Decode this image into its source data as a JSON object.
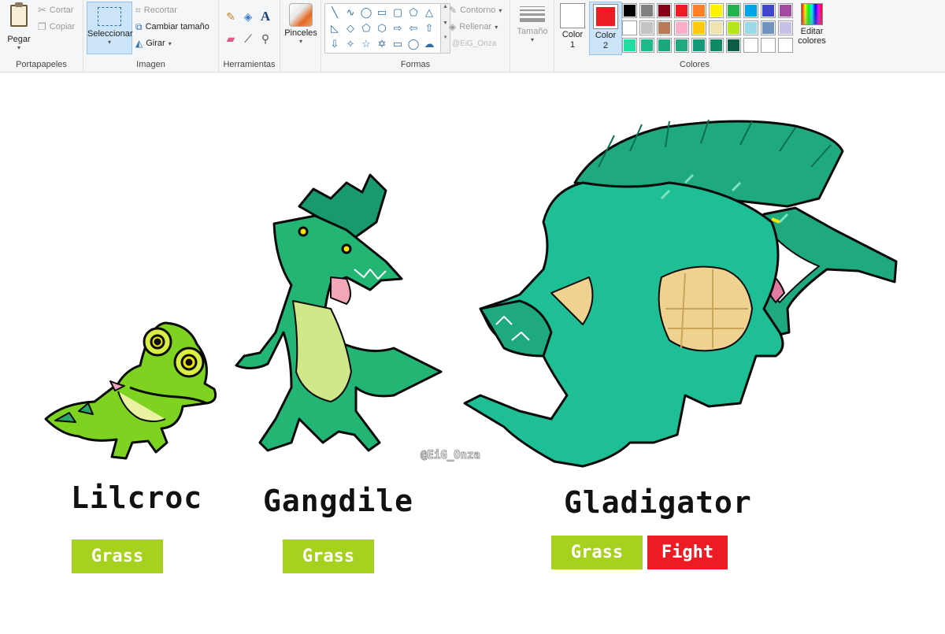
{
  "ribbon": {
    "clipboard": {
      "group_label": "Portapapeles",
      "paste": "Pegar",
      "cut": "Cortar",
      "copy": "Copiar"
    },
    "image": {
      "group_label": "Imagen",
      "select": "Seleccionar",
      "crop": "Recortar",
      "resize": "Cambiar tamaño",
      "rotate": "Girar"
    },
    "tools": {
      "group_label": "Herramientas"
    },
    "brushes": {
      "label": "Pinceles"
    },
    "shapes": {
      "group_label": "Formas",
      "outline": "Contorno",
      "fill": "Rellenar",
      "watermark": "@EiG_Onza"
    },
    "size": {
      "label": "Tamaño"
    },
    "colors": {
      "group_label": "Colores",
      "color1_label": "Color",
      "color1_num": "1",
      "color1_value": "#ffffff",
      "color2_label": "Color",
      "color2_num": "2",
      "color2_value": "#ed1c24",
      "edit_label_1": "Editar",
      "edit_label_2": "colores",
      "palette_row1": [
        "#000000",
        "#7f7f7f",
        "#880015",
        "#ed1c24",
        "#ff7f27",
        "#fff200",
        "#22b14c",
        "#00a2e8",
        "#3f48cc",
        "#a349a4"
      ],
      "palette_row2": [
        "#ffffff",
        "#c3c3c3",
        "#b97a57",
        "#ffaec9",
        "#ffc90e",
        "#efe4b0",
        "#b5e61d",
        "#99d9ea",
        "#7092be",
        "#c8bfe7"
      ],
      "palette_row3": [
        "#1bdfa0",
        "#1abc8c",
        "#18a87c",
        "#1fa97e",
        "#129978",
        "#0e8a64",
        "#0b5e45",
        "#ffffff",
        "#ffffff",
        "#ffffff"
      ]
    }
  },
  "canvas": {
    "monsters": [
      {
        "name": "Lilcroc",
        "types": [
          {
            "label": "Grass",
            "color": "#a7d11f"
          }
        ]
      },
      {
        "name": "Gangdile",
        "types": [
          {
            "label": "Grass",
            "color": "#a7d11f"
          }
        ]
      },
      {
        "name": "Gladigator",
        "types": [
          {
            "label": "Grass",
            "color": "#a7d11f"
          },
          {
            "label": "Fight",
            "color": "#ed1c24"
          }
        ]
      }
    ],
    "credit": "@EiG_Onza"
  }
}
